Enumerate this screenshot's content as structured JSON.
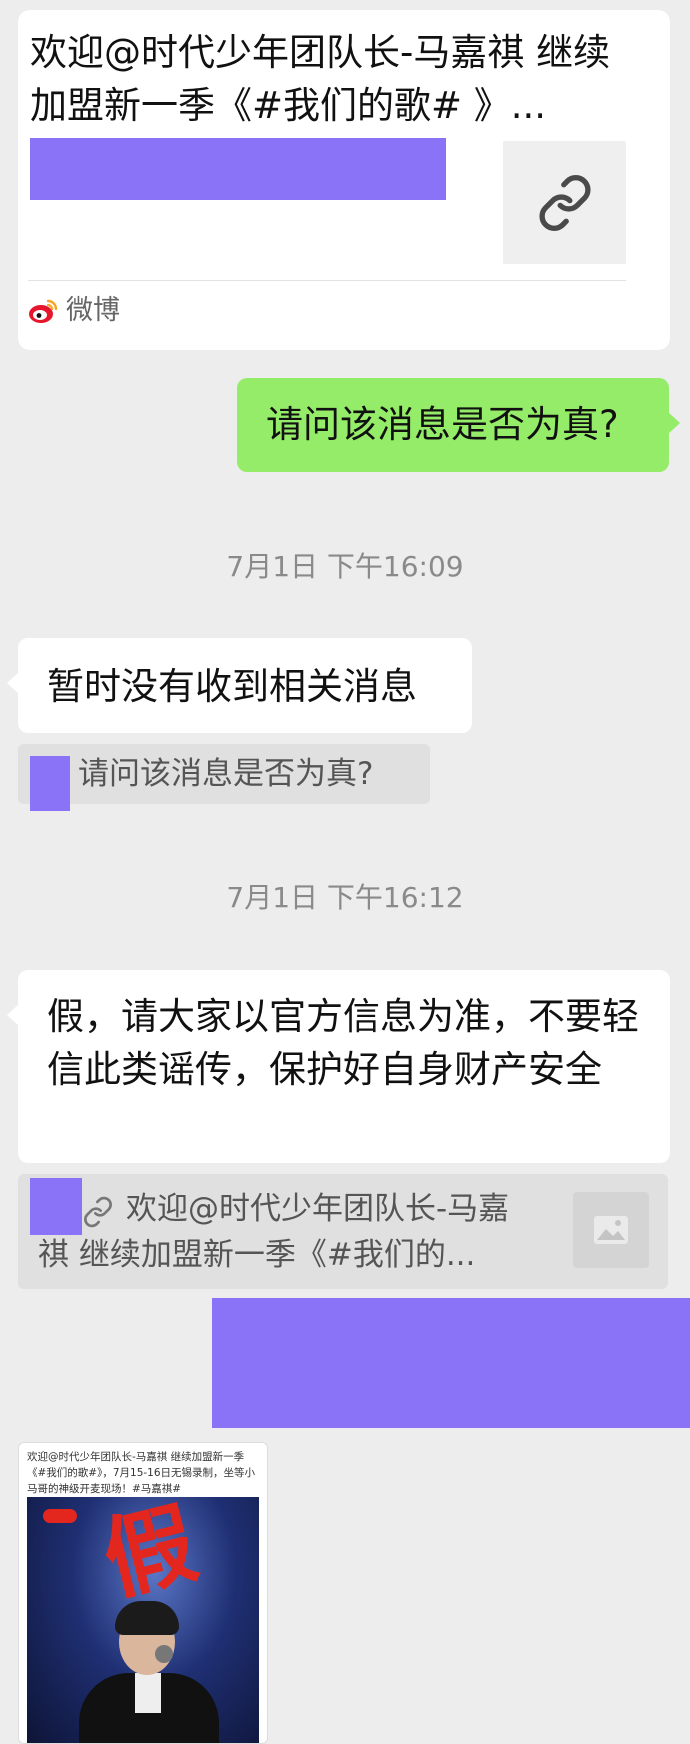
{
  "link_card": {
    "title": "欢迎@时代少年团队长-马嘉祺 继续加盟新一季《#我们的歌# 》...",
    "source_name": "微博",
    "thumbnail_icon": "link-icon",
    "source_icon": "weibo-icon"
  },
  "messages": {
    "outgoing_question": "请问该消息是否为真?",
    "time_1": "7月1日 下午16:09",
    "reply_1": "暂时没有收到相关消息",
    "quote_1": "请问该消息是否为真?",
    "time_2": "7月1日 下午16:12",
    "reply_2": "假，请大家以官方信息为准，不要轻信此类谣传，保护好自身财产安全",
    "quote_2": "欢迎@时代少年团队长-马嘉祺 继续加盟新一季《#我们的...",
    "quote_2_icon": "link-icon",
    "quote_2_thumb_icon": "image-icon"
  },
  "screenshot_image": {
    "caption": "欢迎@时代少年团队长-马嘉祺 继续加盟新一季《#我们的歌#》，7月15-16日无锡录制，坐等小马哥的神级开麦现场！#马嘉祺#",
    "stamp": "假"
  },
  "colors": {
    "background": "#ededed",
    "green_bubble": "#95ec69",
    "redaction": "#8b73f7",
    "stamp_red": "#e3271f"
  }
}
